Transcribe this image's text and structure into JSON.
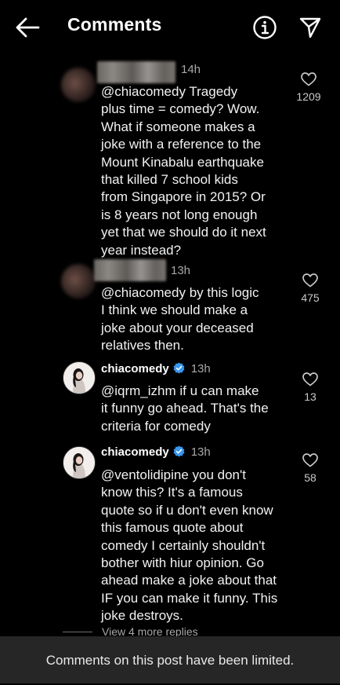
{
  "header": {
    "title": "Comments",
    "back_icon": "arrow-left-icon",
    "info_icon": "info-circle-icon",
    "share_icon": "paper-plane-icon"
  },
  "comments": [
    {
      "username": "",
      "time": "14h",
      "text": "@chiacomedy Tragedy\nplus time = comedy? Wow.\nWhat if someone makes a\njoke with a reference to the\nMount Kinabalu earthquake\nthat killed 7 school kids\nfrom Singapore in 2015? Or\nis 8 years not long enough\nyet that we should do it next\nyear instead?",
      "likes": "1209"
    },
    {
      "username": "",
      "time": "13h",
      "text": "@chiacomedy by this logic\nI think we should make a\njoke about your deceased\nrelatives then.",
      "likes": "475"
    },
    {
      "username": "chiacomedy",
      "time": "13h",
      "verified": true,
      "text": "@iqrm_izhm if u can make\nit funny go ahead. That's the\ncriteria for comedy",
      "likes": "13"
    },
    {
      "username": "chiacomedy",
      "time": "13h",
      "verified": true,
      "text": "@ventolidipine you don't\nknow this? It's a  famous\nquote so if u don't even know\nthis famous quote about\ncomedy I certainly shouldn't\nbother with hiur opinion. Go\nahead make a joke about that\nIF you can make it funny. This\njoke destroys.",
      "likes": "58"
    }
  ],
  "view_more": "View 4 more replies",
  "footer": {
    "limited_text": "Comments on this post have been limited."
  },
  "colors": {
    "background": "#000000",
    "text": "#f2f2f2",
    "muted": "#a8a8a8",
    "footer_bg": "#262626",
    "verified": "#3897f0"
  }
}
